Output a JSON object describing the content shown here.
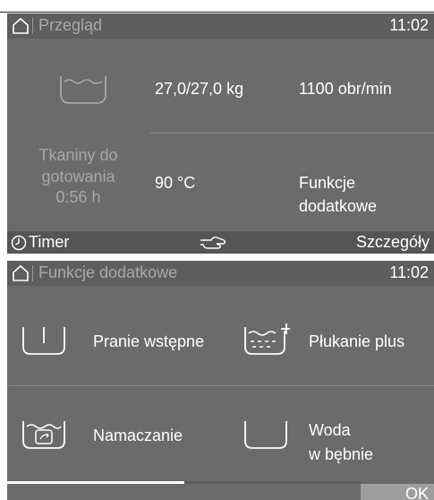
{
  "overview": {
    "title": "Przegląd",
    "time": "11:02",
    "load": "27,0/27,0 kg",
    "spin": "1100 obr/min",
    "program_line1": "Tkaniny do",
    "program_line2": "gotowania",
    "program_line3": "0:56  h",
    "temperature": "90 °C",
    "extra_line1": "Funkcje",
    "extra_line2": "dodatkowe",
    "footer": {
      "timer_label": "Timer",
      "details_label": "Szczegóły"
    }
  },
  "extras": {
    "title": "Funkcje dodatkowe",
    "time": "11:02",
    "options": [
      {
        "label": "Pranie wstępne",
        "icon": "prewash-icon"
      },
      {
        "label": "Płukanie plus",
        "icon": "rinse-plus-icon"
      },
      {
        "label": "Namaczanie",
        "icon": "soak-icon"
      },
      {
        "label_line1": "Woda",
        "label_line2": "w bębnie",
        "icon": "water-in-drum-icon"
      }
    ],
    "ok_label": "OK",
    "scroll_progress": 0.5
  },
  "colors": {
    "background": "#6b6b6b",
    "header": "#5e5e5e",
    "text": "#ffffff",
    "dim_text": "#a8a8a8"
  }
}
